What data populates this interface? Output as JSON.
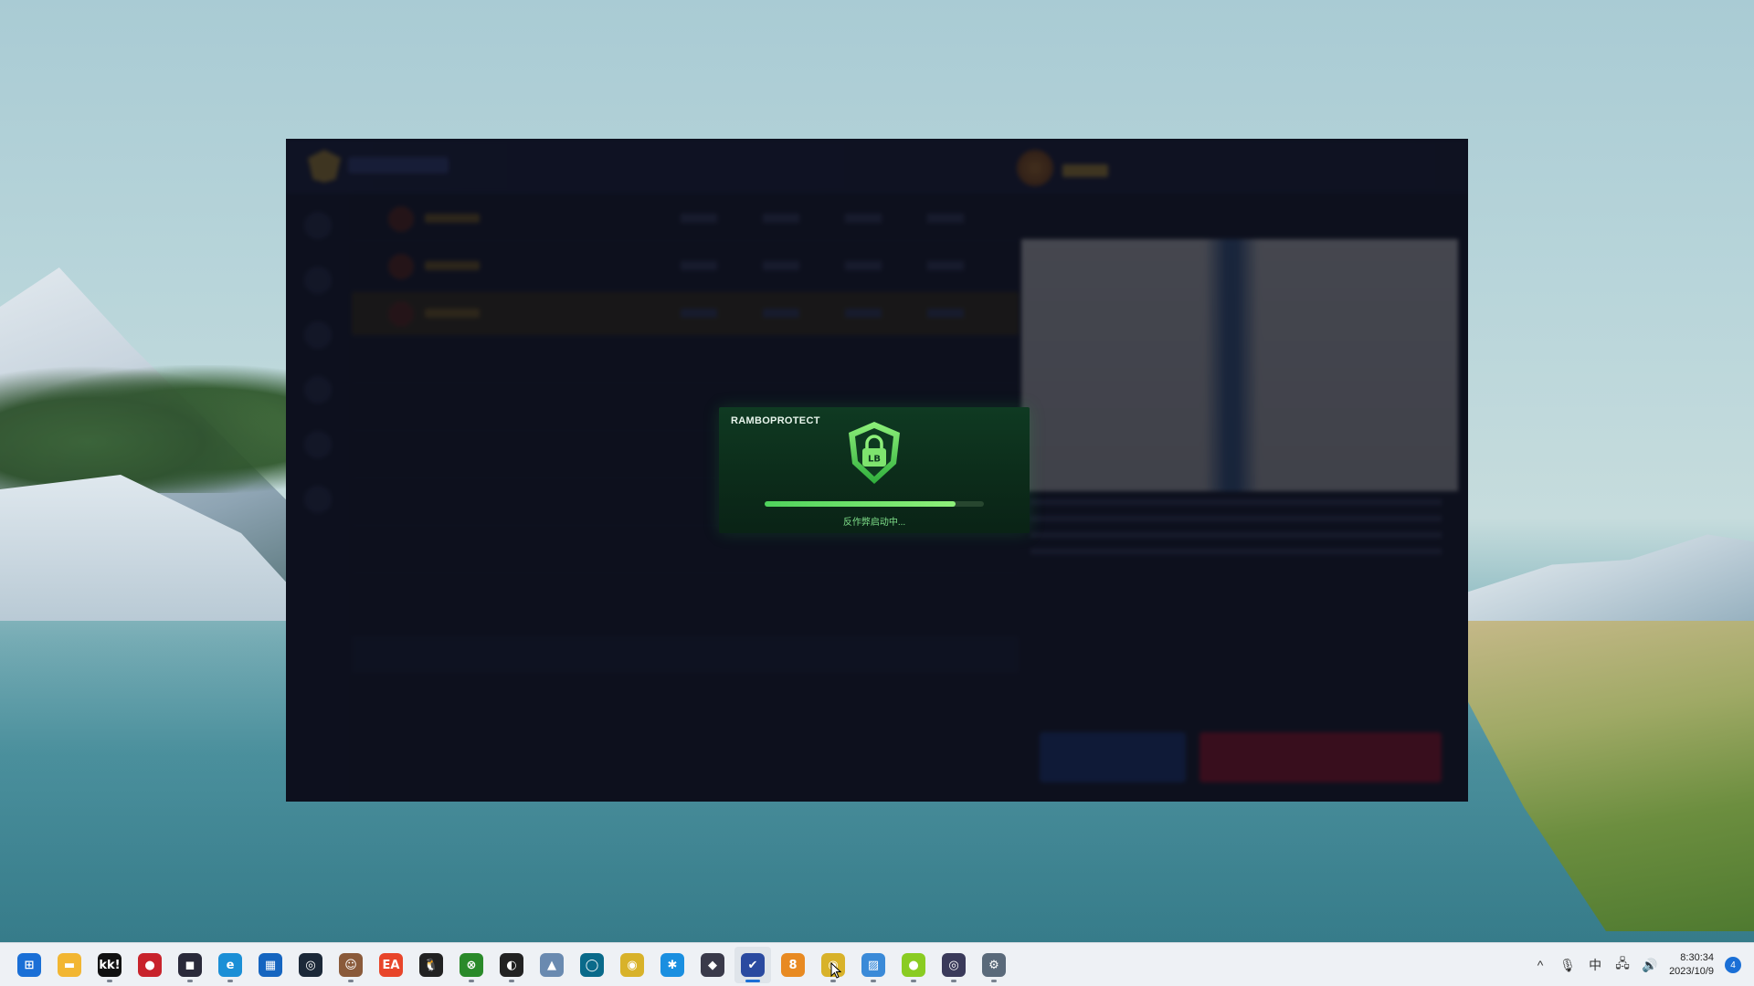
{
  "splash": {
    "title": "RAMBOPROTECT",
    "status": "反作弊启动中...",
    "progress": 0.87,
    "shield_label": "LB",
    "accent": "#4fd35c"
  },
  "taskbar": {
    "apps": [
      {
        "name": "start-button",
        "glyph": "⊞",
        "bg": "#1a6fd6",
        "active": false,
        "running": false
      },
      {
        "name": "file-explorer-icon",
        "glyph": "▬",
        "bg": "#f2b632",
        "active": false,
        "running": false
      },
      {
        "name": "kk-app-icon",
        "glyph": "kk!",
        "bg": "#111111",
        "active": false,
        "running": true
      },
      {
        "name": "tgp-app-icon",
        "glyph": "●",
        "bg": "#c8232c",
        "active": false,
        "running": false
      },
      {
        "name": "dark-game-icon",
        "glyph": "◼",
        "bg": "#2a2a3a",
        "active": false,
        "running": true
      },
      {
        "name": "edge-browser-icon",
        "glyph": "e",
        "bg": "#1b8fd6",
        "active": false,
        "running": true
      },
      {
        "name": "ms-store-icon",
        "glyph": "▦",
        "bg": "#1565c0",
        "active": false,
        "running": false
      },
      {
        "name": "steam-icon",
        "glyph": "◎",
        "bg": "#1b2838",
        "active": false,
        "running": false
      },
      {
        "name": "avatar-app-icon",
        "glyph": "☺",
        "bg": "#8a5a3a",
        "active": false,
        "running": true
      },
      {
        "name": "ea-app-icon",
        "glyph": "EA",
        "bg": "#e8452a",
        "active": false,
        "running": false
      },
      {
        "name": "qq-icon",
        "glyph": "🐧",
        "bg": "#222222",
        "active": false,
        "running": false
      },
      {
        "name": "xbox-icon",
        "glyph": "⊗",
        "bg": "#2a8a2a",
        "active": false,
        "running": true
      },
      {
        "name": "game-launcher-icon",
        "glyph": "◐",
        "bg": "#222222",
        "active": false,
        "running": true
      },
      {
        "name": "monitor-app-icon",
        "glyph": "▲",
        "bg": "#6a8ab0",
        "active": false,
        "running": false
      },
      {
        "name": "ring-app-icon",
        "glyph": "◯",
        "bg": "#0a6a8a",
        "active": false,
        "running": false
      },
      {
        "name": "glasses-app-icon",
        "glyph": "◉",
        "bg": "#d8b22a",
        "active": false,
        "running": false
      },
      {
        "name": "battlenet-icon",
        "glyph": "✱",
        "bg": "#1a8fe0",
        "active": false,
        "running": false
      },
      {
        "name": "cube-app-icon",
        "glyph": "◆",
        "bg": "#3a3a4a",
        "active": false,
        "running": false
      },
      {
        "name": "shield-app-icon",
        "glyph": "✔",
        "bg": "#2a4aa0",
        "active": true,
        "running": true
      },
      {
        "name": "orange-app-icon",
        "glyph": "8",
        "bg": "#e88a22",
        "active": false,
        "running": false
      },
      {
        "name": "rambo-glasses-icon",
        "glyph": "◉",
        "bg": "#d8b22a",
        "active": false,
        "running": true
      },
      {
        "name": "photo-viewer-icon",
        "glyph": "▨",
        "bg": "#3a8ad8",
        "active": false,
        "running": true
      },
      {
        "name": "green-app-icon",
        "glyph": "●",
        "bg": "#8acc22",
        "active": false,
        "running": true
      },
      {
        "name": "spiral-app-icon",
        "glyph": "◎",
        "bg": "#3a3a5a",
        "active": false,
        "running": true
      },
      {
        "name": "settings-icon",
        "glyph": "⚙",
        "bg": "#5a6a7a",
        "active": false,
        "running": true
      }
    ],
    "tray": {
      "chevron": "^",
      "mic": "🎙",
      "ime": "中",
      "network": "🖧",
      "volume": "🔊",
      "time": "8:30:34",
      "date": "2023/10/9",
      "notifications": "4"
    }
  }
}
